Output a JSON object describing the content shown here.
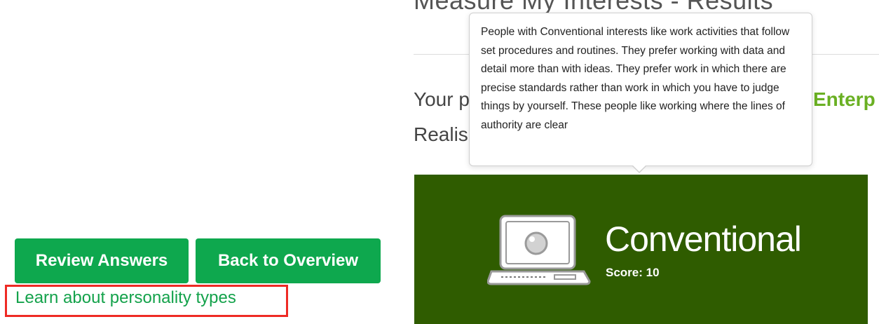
{
  "heading": {
    "title": "Measure My Interests - Results"
  },
  "intro": {
    "line1_visible": "Your p",
    "line2_visible": "Realis",
    "highlighted_type": "Enterp"
  },
  "tooltip": {
    "text": "People with Conventional interests like work activities that follow set procedures and routines. They prefer working with data and detail more than with ideas. They prefer work in which there are precise standards rather than work in which you have to judge things by yourself. These people like working where the lines of authority are clear"
  },
  "result_card": {
    "title": "Conventional",
    "score_label": "Score: 10",
    "icon": "laptop-icon",
    "background_color": "#2f5c00"
  },
  "buttons": {
    "review_label": "Review Answers",
    "back_label": "Back to Overview",
    "color": "#0ea84e"
  },
  "link": {
    "label": "Learn about personality types",
    "color": "#14a24b",
    "annotation_color": "#ee2a24"
  }
}
